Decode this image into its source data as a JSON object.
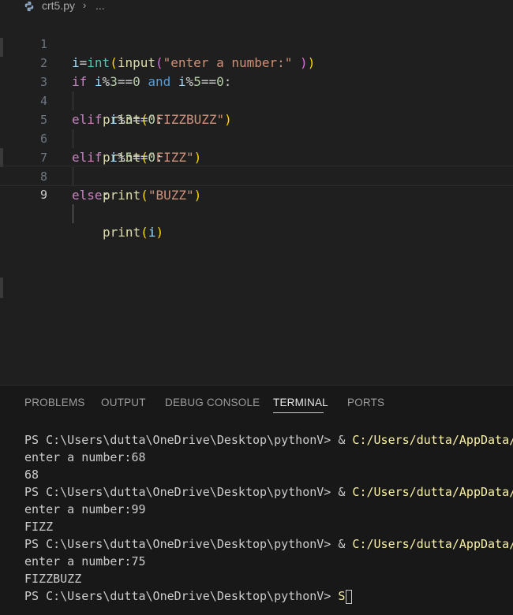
{
  "breadcrumb": {
    "file": "crt5.py",
    "separator": "›",
    "more": "..."
  },
  "editor": {
    "active_line": 9,
    "line_numbers": [
      "1",
      "2",
      "3",
      "4",
      "5",
      "6",
      "7",
      "8",
      "9"
    ],
    "lines": {
      "l1": {
        "a": "i",
        "b": "=",
        "c": "int",
        "d": "(",
        "e": "input",
        "f": "(",
        "g": "\"enter a number:\"",
        "h": " ",
        "i": ")",
        "j": ")"
      },
      "l2": {
        "a": "if",
        "b": " ",
        "c": "i",
        "d": "%",
        "e": "3",
        "f": "==",
        "g": "0",
        "h": " and ",
        "i": "i",
        "j": "%",
        "k": "5",
        "l": "==",
        "m": "0",
        "n": ":"
      },
      "l3": {
        "a": "print",
        "b": "(",
        "c": "\"FIZZBUZZ\"",
        "d": ")"
      },
      "l4": {
        "a": "elif",
        "b": " ",
        "c": "i",
        "d": "%",
        "e": "3",
        "f": "==",
        "g": "0",
        "h": ":"
      },
      "l5": {
        "a": "print",
        "b": "(",
        "c": "\"FIZZ\"",
        "d": ")"
      },
      "l6": {
        "a": "elif",
        "b": " ",
        "c": "i",
        "d": "%",
        "e": "5",
        "f": "==",
        "g": "0",
        "h": ":"
      },
      "l7": {
        "a": "print",
        "b": "(",
        "c": "\"BUZZ\"",
        "d": ")"
      },
      "l8": {
        "a": "else",
        "b": ":"
      },
      "l9": {
        "a": "print",
        "b": "(",
        "c": "i",
        "d": ")"
      }
    }
  },
  "panel": {
    "tabs": [
      "PROBLEMS",
      "OUTPUT",
      "DEBUG CONSOLE",
      "TERMINAL",
      "PORTS"
    ],
    "active_tab": "TERMINAL"
  },
  "terminal": {
    "prompt": "PS C:\\Users\\dutta\\OneDrive\\Desktop\\pythonV> ",
    "amp": "& ",
    "cmd_path": "C:/Users/dutta/AppData/",
    "input_prompt": "enter a number:",
    "runs": [
      {
        "input": "68",
        "output": "68"
      },
      {
        "input": "99",
        "output": "FIZZ"
      },
      {
        "input": "75",
        "output": "FIZZBUZZ"
      }
    ],
    "typed": "S"
  },
  "colors": {
    "editor_bg": "#1f1f1f",
    "panel_bg": "#181818",
    "keyword": "#569cd6",
    "control": "#c586c0",
    "function": "#dcdcaa",
    "string": "#ce9178",
    "number": "#b5cea8",
    "variable": "#9cdcfe",
    "bracket_gold": "#ffd700",
    "bracket_pink": "#da70d6",
    "terminal_path": "#f9f1a5"
  }
}
